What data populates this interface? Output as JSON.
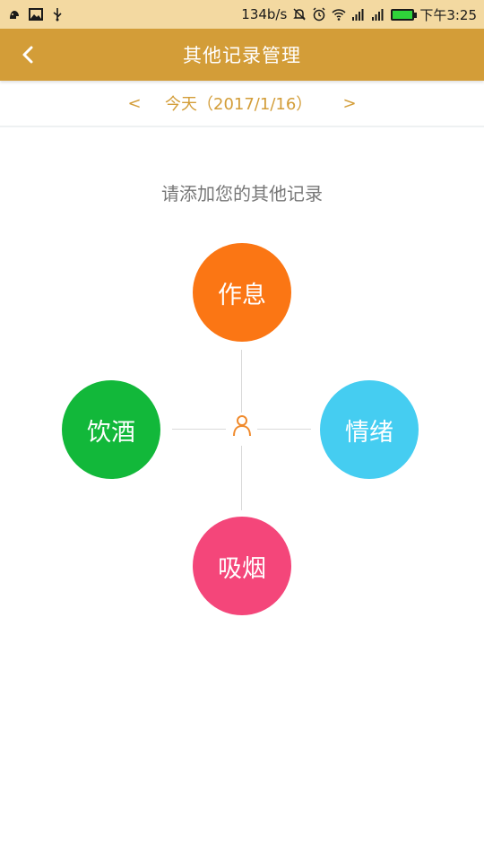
{
  "status_bar": {
    "speed": "134b/s",
    "time": "下午3:25",
    "icons": [
      "notification-icon",
      "image-icon",
      "usb-icon",
      "mute-icon",
      "alarm-icon",
      "wifi-icon",
      "signal-icon",
      "signal-icon",
      "battery-icon"
    ]
  },
  "app_bar": {
    "title": "其他记录管理",
    "back_icon": "back-arrow-icon"
  },
  "date_nav": {
    "prev": "<",
    "label": "今天（2017/1/16）",
    "next": ">"
  },
  "main": {
    "prompt": "请添加您的其他记录",
    "center_icon": "person-icon",
    "items": [
      {
        "label": "作息",
        "color": "#fb7614"
      },
      {
        "label": "饮酒",
        "color": "#12b83a"
      },
      {
        "label": "情绪",
        "color": "#45cdf1"
      },
      {
        "label": "吸烟",
        "color": "#f4467a"
      }
    ]
  },
  "colors": {
    "accent": "#d39d38",
    "status_bar_bg": "#f3d9a1"
  }
}
